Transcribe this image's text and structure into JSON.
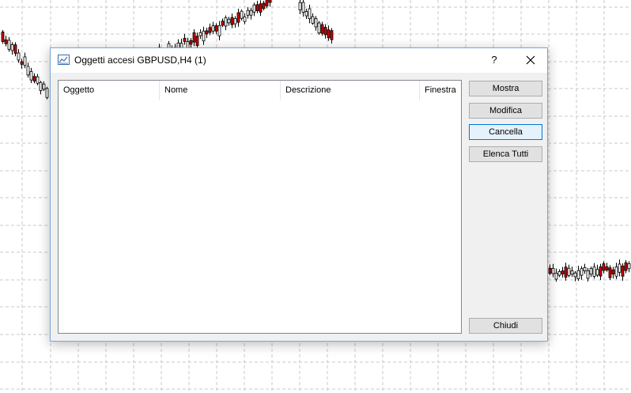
{
  "dialog": {
    "title": "Oggetti accesi GBPUSD,H4 (1)",
    "help_label": "?",
    "icons": {
      "app": "chart-window-icon",
      "close": "close-icon"
    }
  },
  "list": {
    "columns": [
      "Oggetto",
      "Nome",
      "Descrizione",
      "Finestra"
    ],
    "rows": []
  },
  "buttons": {
    "mostra": "Mostra",
    "modifica": "Modifica",
    "cancella": "Cancella",
    "elenca": "Elenca Tutti",
    "chiudi": "Chiudi"
  },
  "colors": {
    "accent": "#0078d7",
    "bull_candle": "#ffffff",
    "bear_candle": "#d40000",
    "chart_grid": "#c8c8c8"
  }
}
